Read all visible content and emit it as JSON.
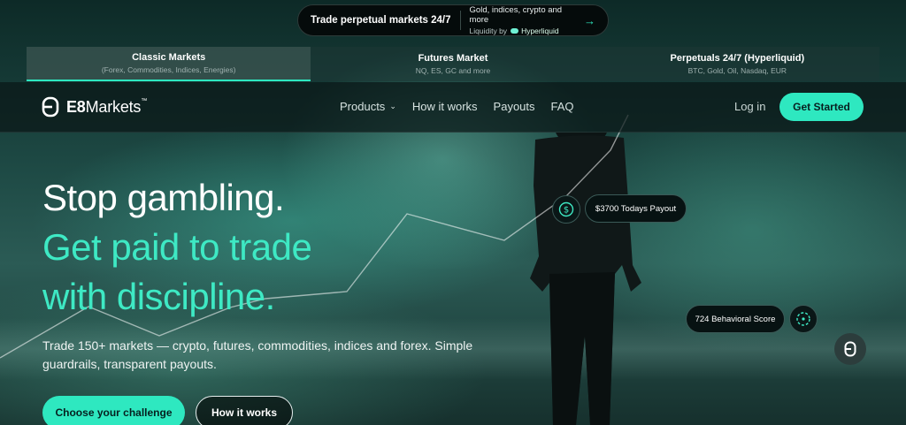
{
  "announcement": {
    "title": "Trade perpetual markets 24/7",
    "subtitle": "Gold, indices, crypto and more",
    "liquidity_label": "Liquidity by",
    "liquidity_brand": "Hyperliquid",
    "arrow_icon": "arrow-right-icon"
  },
  "market_tabs": [
    {
      "title": "Classic Markets",
      "subtitle": "(Forex, Commodities, Indices, Energies)"
    },
    {
      "title": "Futures Market",
      "subtitle": "NQ, ES, GC and more"
    },
    {
      "title": "Perpetuals 24/7 (Hyperliquid)",
      "subtitle": "BTC, Gold, Oil, Nasdaq, EUR"
    }
  ],
  "nav": {
    "logo_bold": "E8",
    "logo_rest": "Markets",
    "logo_tm": "™",
    "links": [
      "Products",
      "How it works",
      "Payouts",
      "FAQ"
    ],
    "login": "Log in",
    "cta": "Get Started"
  },
  "hero": {
    "line1": "Stop gambling.",
    "line2": "Get paid to trade",
    "line3": "with discipline.",
    "description": "Trade 150+ markets — crypto, futures, commodities, indices and forex. Simple guardrails, transparent payouts.",
    "primary_cta": "Choose your challenge",
    "secondary_cta": "How it works"
  },
  "floating": {
    "payout_badge": "$3700 Todays Payout",
    "score_badge": "724 Behavioral Score"
  },
  "colors": {
    "accent": "#2ee8c0",
    "heading_teal": "#3ee9c4"
  }
}
